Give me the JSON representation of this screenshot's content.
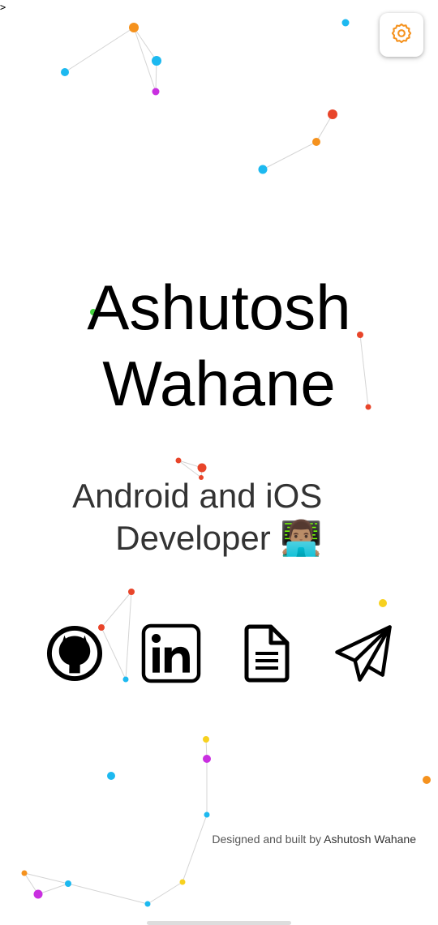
{
  "prompt": ">",
  "settings": {
    "icon": "gear-icon",
    "accent": "#F5921E"
  },
  "hero": {
    "name_line1": "Ashutosh",
    "name_line2": "Wahane",
    "role_line1": "Android and iOS  ",
    "role_line2": "Developer",
    "role_emoji": "👨🏽‍💻"
  },
  "social_links": [
    {
      "icon": "github-icon"
    },
    {
      "icon": "linkedin-icon"
    },
    {
      "icon": "resume-document-icon"
    },
    {
      "icon": "telegram-send-icon"
    }
  ],
  "footer": {
    "prefix": "Designed and built by ",
    "author": "Ashutosh Wahane"
  },
  "particle_colors": [
    "#F5921E",
    "#1DB9F0",
    "#C92FE0",
    "#E8452A",
    "#F7D11F",
    "#44D33D"
  ]
}
